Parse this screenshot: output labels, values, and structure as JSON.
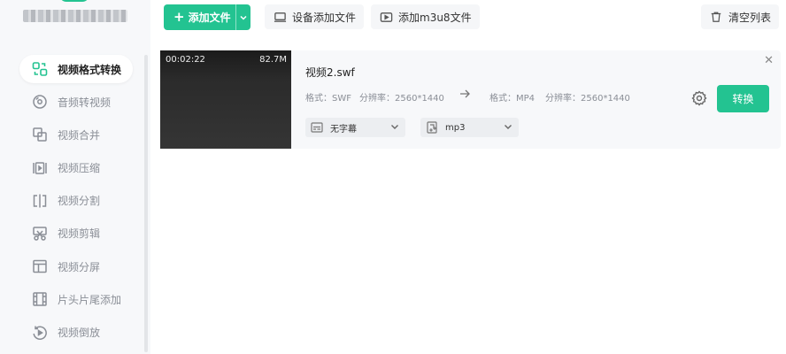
{
  "app": {
    "title": "███ ██ ███",
    "accent": "#23c391"
  },
  "sidebar": {
    "items": [
      {
        "label": "视频格式转换",
        "icon": "convert-format-icon",
        "active": true
      },
      {
        "label": "音频转视频",
        "icon": "disc-icon"
      },
      {
        "label": "视频合并",
        "icon": "merge-icon"
      },
      {
        "label": "视频压缩",
        "icon": "compress-icon"
      },
      {
        "label": "视频分割",
        "icon": "split-icon"
      },
      {
        "label": "视频剪辑",
        "icon": "scissors-icon"
      },
      {
        "label": "视频分屏",
        "icon": "split-screen-icon"
      },
      {
        "label": "片头片尾添加",
        "icon": "film-strip-icon"
      },
      {
        "label": "视频倒放",
        "icon": "reverse-icon"
      }
    ]
  },
  "toolbar": {
    "add_file": "添加文件",
    "device_add": "设备添加文件",
    "add_m3u8": "添加m3u8文件",
    "clear_list": "清空列表"
  },
  "file": {
    "duration": "00:02:22",
    "size": "82.7M",
    "name": "视频2.swf",
    "src_format": "格式：SWF",
    "src_resolution": "分辨率：2560*1440",
    "dst_format": "格式：MP4",
    "dst_resolution": "分辨率：2560*1440",
    "subtitle": "无字幕",
    "audio": "mp3",
    "convert": "转换"
  }
}
